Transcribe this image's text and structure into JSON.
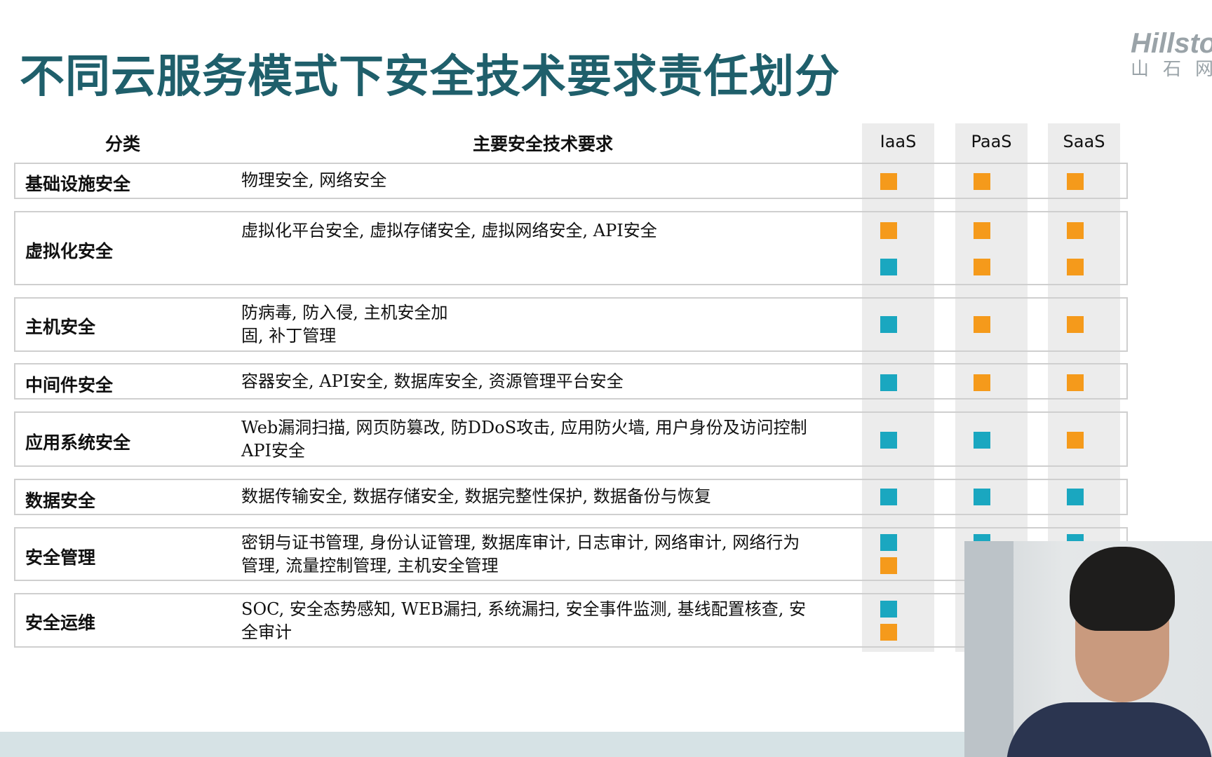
{
  "title": "不同云服务模式下安全技术要求责任划分",
  "logo": {
    "main": "Hillstone",
    "sub": "山石网科"
  },
  "colors": {
    "title": "#1f5f6b",
    "provider": "#f59a1b",
    "customer": "#1aa7c0",
    "column_bg": "#ececec"
  },
  "table": {
    "header": {
      "category": "分类",
      "requirements": "主要安全技术要求",
      "iaas": "IaaS",
      "paas": "PaaS",
      "saas": "SaaS"
    },
    "rows": [
      {
        "category": "基础设施安全",
        "lines": [
          "物理安全, 网络安全"
        ],
        "iaas": [
          "orange"
        ],
        "paas": [
          "orange"
        ],
        "saas": [
          "orange"
        ]
      },
      {
        "category": "虚拟化安全",
        "lines": [
          "虚拟化平台安全, 虚拟存储安全, 虚拟网络安全, API安全"
        ],
        "iaas": [
          "orange",
          "teal"
        ],
        "paas": [
          "orange",
          "orange"
        ],
        "saas": [
          "orange",
          "orange"
        ]
      },
      {
        "category": "主机安全",
        "lines": [
          "防病毒, 防入侵, 主机安全加",
          "固, 补丁管理"
        ],
        "iaas": [
          "teal"
        ],
        "paas": [
          "orange"
        ],
        "saas": [
          "orange"
        ]
      },
      {
        "category": "中间件安全",
        "lines": [
          "容器安全, API安全, 数据库安全, 资源管理平台安全"
        ],
        "iaas": [
          "teal"
        ],
        "paas": [
          "orange"
        ],
        "saas": [
          "orange"
        ]
      },
      {
        "category": "应用系统安全",
        "lines": [
          "Web漏洞扫描, 网页防篡改, 防DDoS攻击, 应用防火墙, 用户身份及访问控制",
          "API安全"
        ],
        "iaas": [
          "teal"
        ],
        "paas": [
          "teal"
        ],
        "saas": [
          "orange"
        ]
      },
      {
        "category": "数据安全",
        "lines": [
          "数据传输安全, 数据存储安全, 数据完整性保护, 数据备份与恢复"
        ],
        "iaas": [
          "teal"
        ],
        "paas": [
          "teal"
        ],
        "saas": [
          "teal"
        ]
      },
      {
        "category": "安全管理",
        "lines": [
          "密钥与证书管理, 身份认证管理, 数据库审计, 日志审计, 网络审计, 网络行为",
          "管理, 流量控制管理, 主机安全管理"
        ],
        "iaas": [
          "teal",
          "orange"
        ],
        "paas": [
          "teal"
        ],
        "saas": [
          "teal"
        ]
      },
      {
        "category": "安全运维",
        "lines": [
          "SOC, 安全态势感知, WEB漏扫, 系统漏扫, 安全事件监测, 基线配置核查, 安",
          "全审计"
        ],
        "iaas": [
          "teal",
          "orange"
        ],
        "paas": [],
        "saas": []
      }
    ]
  }
}
